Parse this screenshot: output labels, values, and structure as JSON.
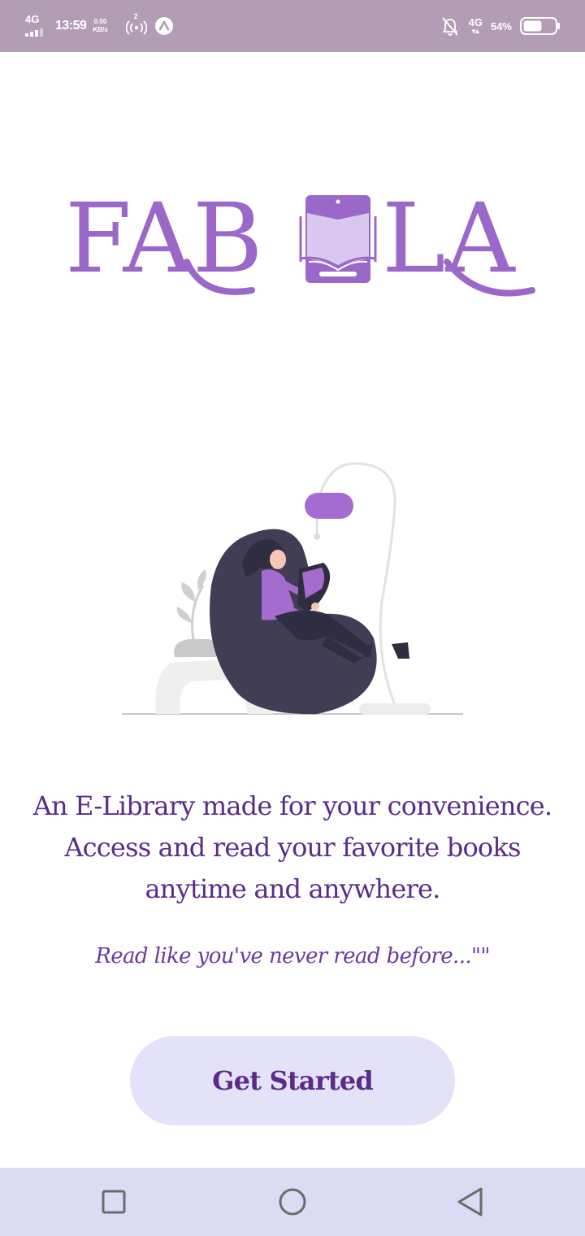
{
  "status_bar": {
    "network_type": "4G",
    "time": "13:59",
    "data_rate_value": "0.00",
    "data_rate_unit": "KB/s",
    "hotspot_count": "2",
    "network_type_right": "4G",
    "battery_percent": "54%",
    "battery_level": 0.54
  },
  "app": {
    "logo_text": "FABOLA",
    "brand_color": "#9b68c9"
  },
  "content": {
    "tagline_line1": "An E-Library made for your convenience.",
    "tagline_line2": "Access and read your favorite books",
    "tagline_line3": "anytime and anywhere.",
    "subtagline": "Read like you've never read before...\"\""
  },
  "actions": {
    "get_started_label": "Get Started"
  },
  "nav": {
    "recent": "square-icon",
    "home": "circle-icon",
    "back": "triangle-back-icon"
  }
}
